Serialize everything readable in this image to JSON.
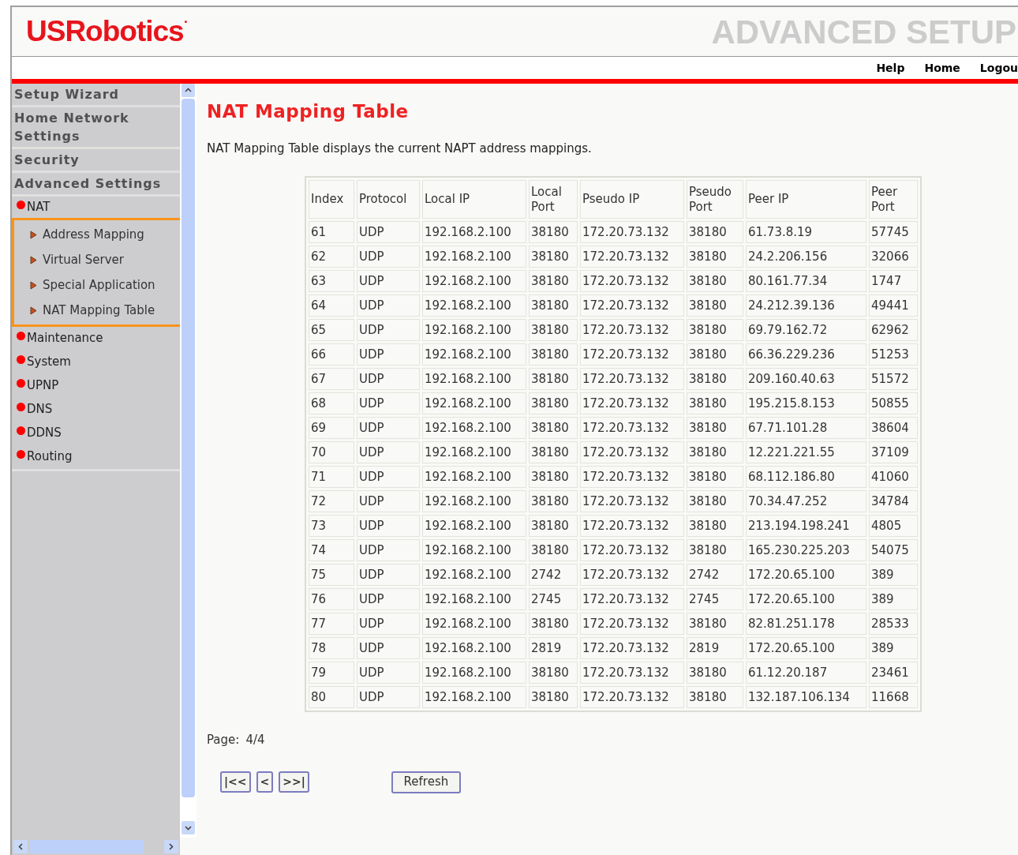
{
  "header": {
    "logo": "USRobotics",
    "logo_mark": "·",
    "title": "ADVANCED SETUP",
    "links": [
      "Help",
      "Home",
      "Logou"
    ]
  },
  "sidebar": {
    "sections": [
      {
        "label": "Setup Wizard"
      },
      {
        "label": "Home Network Settings"
      },
      {
        "label": "Security"
      },
      {
        "label": "Advanced Settings"
      }
    ],
    "items": [
      {
        "label": "NAT",
        "expanded": true,
        "children": [
          {
            "label": "Address Mapping"
          },
          {
            "label": "Virtual Server"
          },
          {
            "label": "Special Application"
          },
          {
            "label": "NAT Mapping Table"
          }
        ]
      },
      {
        "label": "Maintenance",
        "expanded": false
      },
      {
        "label": "System",
        "expanded": false
      },
      {
        "label": "UPNP",
        "expanded": false
      },
      {
        "label": "DNS",
        "expanded": false
      },
      {
        "label": "DDNS",
        "expanded": false
      },
      {
        "label": "Routing",
        "expanded": false
      }
    ]
  },
  "page": {
    "title": "NAT Mapping Table",
    "description": "NAT Mapping Table displays the current NAPT address mappings."
  },
  "table": {
    "columns": [
      "Index",
      "Protocol",
      "Local IP",
      "Local Port",
      "Pseudo IP",
      "Pseudo Port",
      "Peer IP",
      "Peer Port"
    ],
    "rows": [
      [
        "61",
        "UDP",
        "192.168.2.100",
        "38180",
        "172.20.73.132",
        "38180",
        "61.73.8.19",
        "57745"
      ],
      [
        "62",
        "UDP",
        "192.168.2.100",
        "38180",
        "172.20.73.132",
        "38180",
        "24.2.206.156",
        "32066"
      ],
      [
        "63",
        "UDP",
        "192.168.2.100",
        "38180",
        "172.20.73.132",
        "38180",
        "80.161.77.34",
        "1747"
      ],
      [
        "64",
        "UDP",
        "192.168.2.100",
        "38180",
        "172.20.73.132",
        "38180",
        "24.212.39.136",
        "49441"
      ],
      [
        "65",
        "UDP",
        "192.168.2.100",
        "38180",
        "172.20.73.132",
        "38180",
        "69.79.162.72",
        "62962"
      ],
      [
        "66",
        "UDP",
        "192.168.2.100",
        "38180",
        "172.20.73.132",
        "38180",
        "66.36.229.236",
        "51253"
      ],
      [
        "67",
        "UDP",
        "192.168.2.100",
        "38180",
        "172.20.73.132",
        "38180",
        "209.160.40.63",
        "51572"
      ],
      [
        "68",
        "UDP",
        "192.168.2.100",
        "38180",
        "172.20.73.132",
        "38180",
        "195.215.8.153",
        "50855"
      ],
      [
        "69",
        "UDP",
        "192.168.2.100",
        "38180",
        "172.20.73.132",
        "38180",
        "67.71.101.28",
        "38604"
      ],
      [
        "70",
        "UDP",
        "192.168.2.100",
        "38180",
        "172.20.73.132",
        "38180",
        "12.221.221.55",
        "37109"
      ],
      [
        "71",
        "UDP",
        "192.168.2.100",
        "38180",
        "172.20.73.132",
        "38180",
        "68.112.186.80",
        "41060"
      ],
      [
        "72",
        "UDP",
        "192.168.2.100",
        "38180",
        "172.20.73.132",
        "38180",
        "70.34.47.252",
        "34784"
      ],
      [
        "73",
        "UDP",
        "192.168.2.100",
        "38180",
        "172.20.73.132",
        "38180",
        "213.194.198.241",
        "4805"
      ],
      [
        "74",
        "UDP",
        "192.168.2.100",
        "38180",
        "172.20.73.132",
        "38180",
        "165.230.225.203",
        "54075"
      ],
      [
        "75",
        "UDP",
        "192.168.2.100",
        "2742",
        "172.20.73.132",
        "2742",
        "172.20.65.100",
        "389"
      ],
      [
        "76",
        "UDP",
        "192.168.2.100",
        "2745",
        "172.20.73.132",
        "2745",
        "172.20.65.100",
        "389"
      ],
      [
        "77",
        "UDP",
        "192.168.2.100",
        "38180",
        "172.20.73.132",
        "38180",
        "82.81.251.178",
        "28533"
      ],
      [
        "78",
        "UDP",
        "192.168.2.100",
        "2819",
        "172.20.73.132",
        "2819",
        "172.20.65.100",
        "389"
      ],
      [
        "79",
        "UDP",
        "192.168.2.100",
        "38180",
        "172.20.73.132",
        "38180",
        "61.12.20.187",
        "23461"
      ],
      [
        "80",
        "UDP",
        "192.168.2.100",
        "38180",
        "172.20.73.132",
        "38180",
        "132.187.106.134",
        "11668"
      ]
    ]
  },
  "pagination": {
    "label": "Page:",
    "value": "4/4",
    "buttons": [
      "|<<",
      "<",
      ">>|"
    ]
  },
  "refresh_button": "Refresh"
}
